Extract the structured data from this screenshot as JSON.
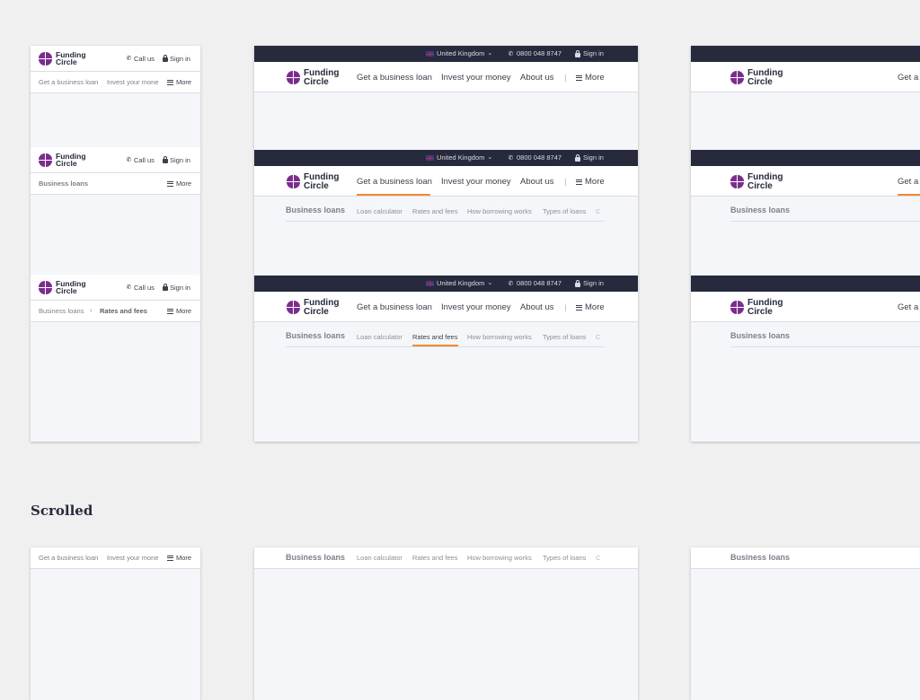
{
  "brand": {
    "line1": "Funding",
    "line2": "Circle"
  },
  "colors": {
    "accent": "#f38a33",
    "topbar": "#262a3c",
    "logo": "#7b2d8e"
  },
  "topbar": {
    "country": "United Kingdom",
    "phone": "0800 048 8747",
    "sign_in": "Sign in"
  },
  "mobile": {
    "call_us": "Call us",
    "sign_in": "Sign in",
    "more": "More",
    "nav": [
      "Get a business loan",
      "Invest your mone"
    ],
    "section_title": "Business loans",
    "breadcrumb_parent": "Business loans",
    "breadcrumb_current": "Rates and fees"
  },
  "desktop": {
    "nav": [
      "Get a business loan",
      "Invest your money",
      "About us"
    ],
    "more": "More",
    "sub_title": "Business loans",
    "sub_items": [
      "Loan calculator",
      "Rates and fees",
      "How borrowing works",
      "Types of loans",
      "C"
    ]
  },
  "wide": {
    "nav_first": "Get a",
    "sub_title": "Business loans"
  },
  "scrolled_heading": "Scrolled"
}
